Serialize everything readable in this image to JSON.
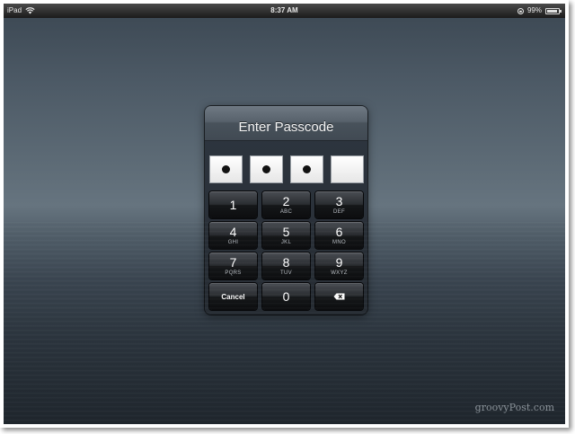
{
  "statusbar": {
    "device": "iPad",
    "time": "8:37 AM",
    "battery": "99%"
  },
  "dialog": {
    "title": "Enter Passcode",
    "digits_entered": 3,
    "digits_total": 4
  },
  "keypad": {
    "keys": [
      {
        "num": "1",
        "letters": ""
      },
      {
        "num": "2",
        "letters": "ABC"
      },
      {
        "num": "3",
        "letters": "DEF"
      },
      {
        "num": "4",
        "letters": "GHI"
      },
      {
        "num": "5",
        "letters": "JKL"
      },
      {
        "num": "6",
        "letters": "MNO"
      },
      {
        "num": "7",
        "letters": "PQRS"
      },
      {
        "num": "8",
        "letters": "TUV"
      },
      {
        "num": "9",
        "letters": "WXYZ"
      }
    ],
    "cancel_label": "Cancel",
    "zero": "0"
  },
  "watermark": "groovyPost.com",
  "icons": {
    "wifi": "wifi-icon",
    "lock": "orientation-lock-icon",
    "battery": "battery-icon",
    "delete": "delete-icon"
  }
}
